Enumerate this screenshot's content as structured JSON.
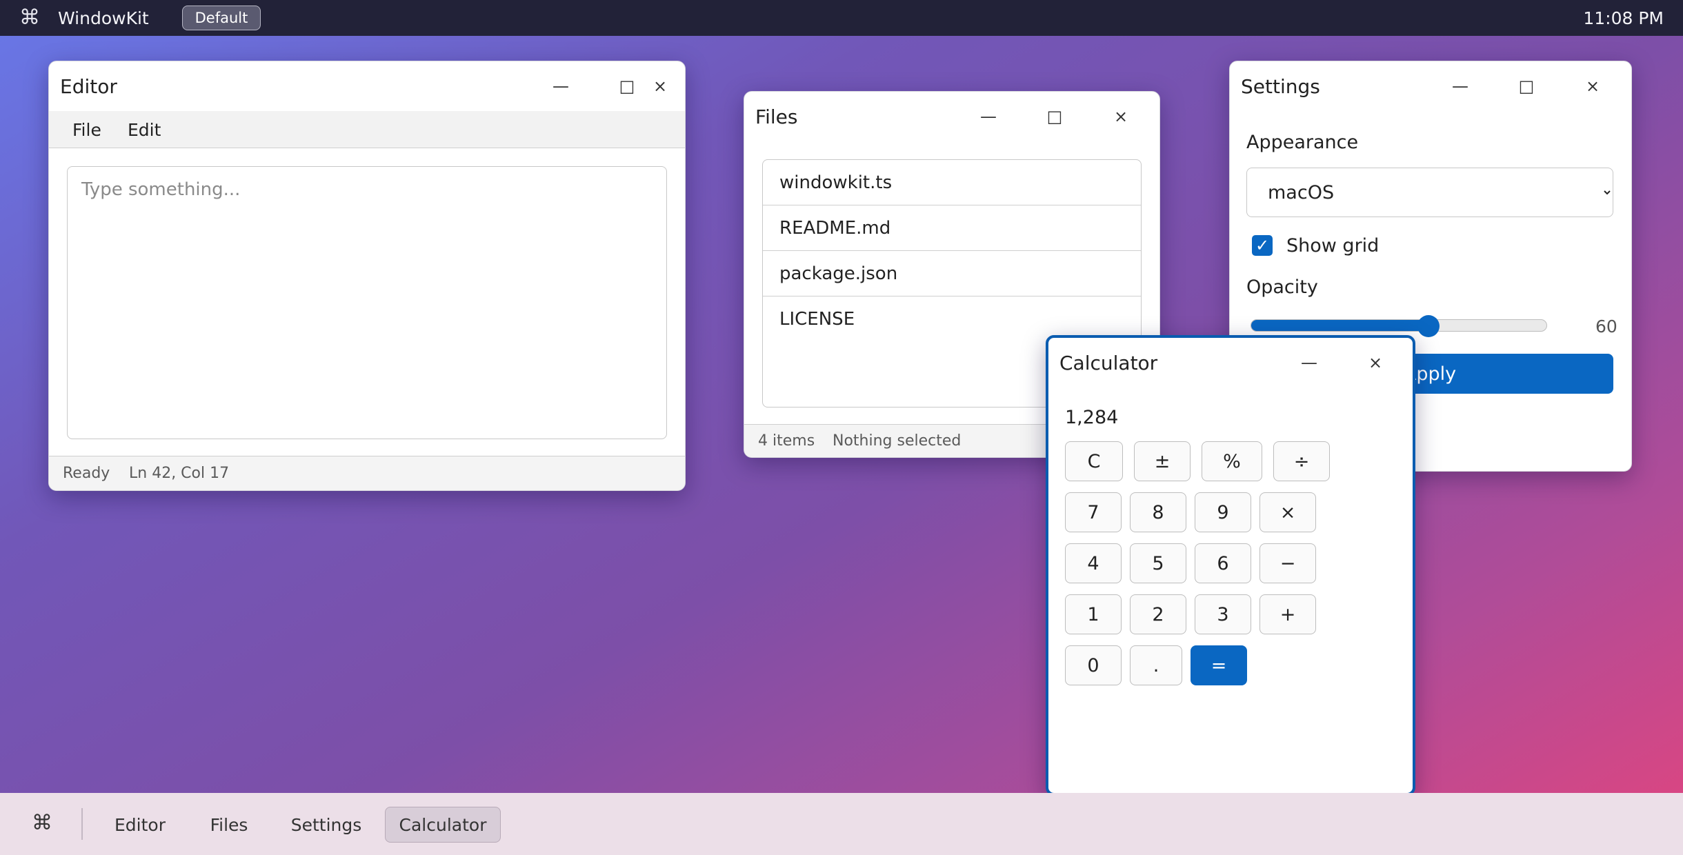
{
  "topbar": {
    "logo_glyph": "⌘",
    "app_name": "WindowKit",
    "theme_button": "Default",
    "clock": "11:08 PM"
  },
  "editor": {
    "title": "Editor",
    "controls": {
      "minimize": "—",
      "maximize": "□",
      "close": "×"
    },
    "menu": [
      "File",
      "Edit"
    ],
    "textarea_placeholder": "Type something...",
    "status": {
      "state": "Ready",
      "position": "Ln 42, Col 17"
    }
  },
  "files": {
    "title": "Files",
    "controls": {
      "minimize": "—",
      "maximize": "□",
      "close": "×"
    },
    "items": [
      "windowkit.ts",
      "README.md",
      "package.json",
      "LICENSE"
    ],
    "status": {
      "count": "4 items",
      "selection": "Nothing selected"
    }
  },
  "settings": {
    "title": "Settings",
    "controls": {
      "minimize": "—",
      "maximize": "□",
      "close": "×"
    },
    "appearance_label": "Appearance",
    "appearance_value": "macOS",
    "show_grid_label": "Show grid",
    "show_grid_checked": true,
    "opacity_label": "Opacity",
    "opacity_value": "60",
    "apply_label": "Apply"
  },
  "calculator": {
    "title": "Calculator",
    "controls": {
      "minimize": "—",
      "close": "×"
    },
    "display": "1,284",
    "keys": [
      "C",
      "±",
      "%",
      "÷",
      "7",
      "8",
      "9",
      "×",
      "4",
      "5",
      "6",
      "−",
      "1",
      "2",
      "3",
      "+",
      "0",
      ".",
      "="
    ]
  },
  "taskbar": {
    "logo_glyph": "⌘",
    "tasks": [
      "Editor",
      "Files",
      "Settings",
      "Calculator"
    ],
    "active_task": "Calculator"
  },
  "colors": {
    "accent": "#0a67c2",
    "topbar": "#222238",
    "taskbar": "#ecdfe8"
  }
}
